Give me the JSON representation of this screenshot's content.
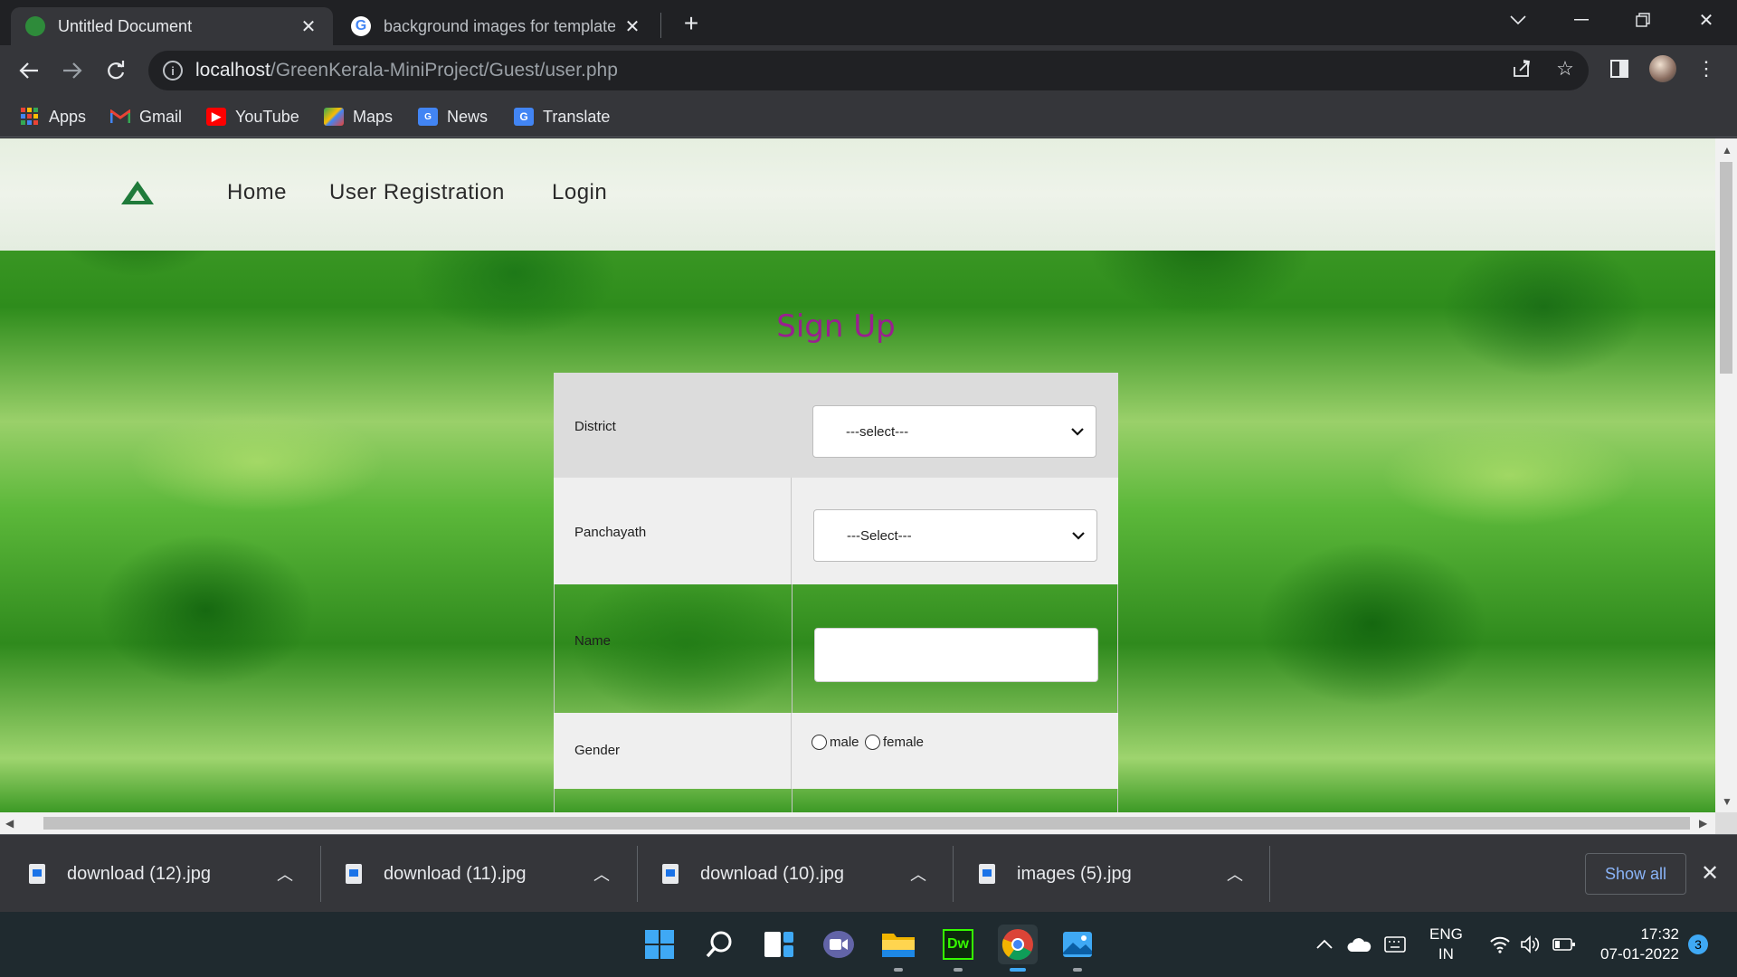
{
  "browser": {
    "tabs": [
      {
        "title": "Untitled Document",
        "active": true
      },
      {
        "title": "background images for template",
        "active": false
      }
    ],
    "url_host": "localhost",
    "url_path": "/GreenKerala-MiniProject/Guest/user.php",
    "bookmarks": [
      "Apps",
      "Gmail",
      "YouTube",
      "Maps",
      "News",
      "Translate"
    ]
  },
  "site": {
    "nav": [
      "Home",
      "User Registration",
      "Login"
    ]
  },
  "form": {
    "title": "Sign Up",
    "district_label": "District",
    "district_value": "---select---",
    "panchayath_label": "Panchayath",
    "panchayath_value": "---Select---",
    "name_label": "Name",
    "name_value": "",
    "gender_label": "Gender",
    "gender_options": [
      "male",
      "female"
    ]
  },
  "downloads": {
    "items": [
      "download (12).jpg",
      "download (11).jpg",
      "download (10).jpg",
      "images (5).jpg"
    ],
    "show_all": "Show all"
  },
  "taskbar": {
    "lang_top": "ENG",
    "lang_bottom": "IN",
    "time": "17:32",
    "date": "07-01-2022",
    "notification_count": "3"
  },
  "colors": {
    "title_purple": "#9a1f8f",
    "chrome_dark": "#202124",
    "chrome_mid": "#35363a"
  }
}
